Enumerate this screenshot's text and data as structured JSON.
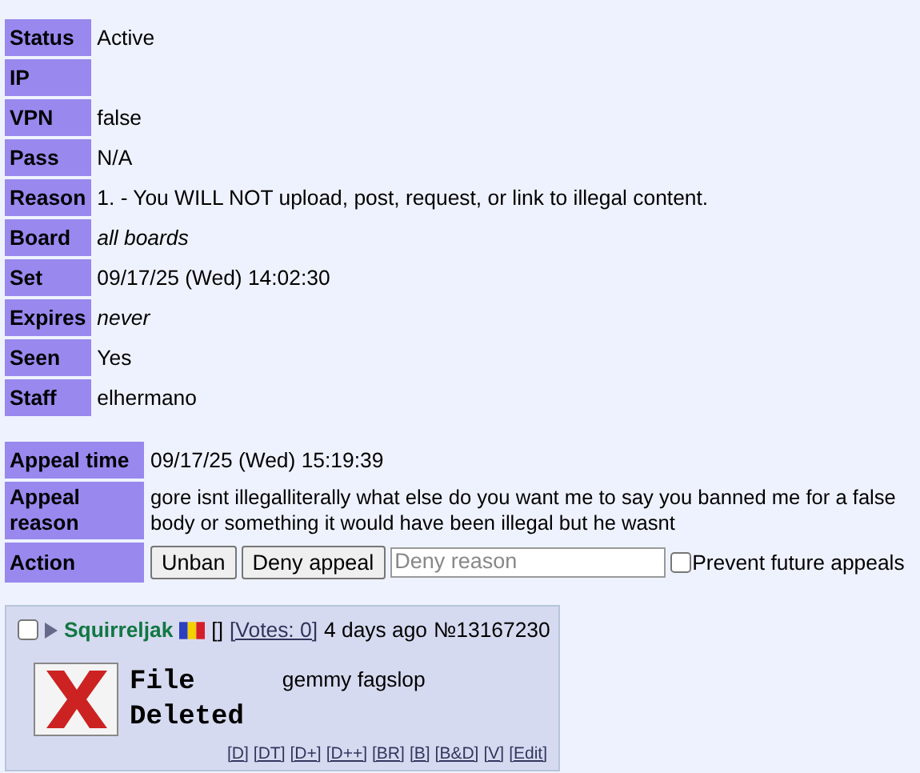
{
  "ban_details": [
    {
      "label": "Status",
      "value": "Active",
      "italic": false
    },
    {
      "label": "IP"
    },
    {
      "label": "VPN",
      "value": "false",
      "italic": false
    },
    {
      "label": "Pass",
      "value": "N/A",
      "italic": false
    },
    {
      "label": "Reason",
      "value": "1. - You WILL NOT upload, post, request, or link to illegal content.",
      "italic": false
    },
    {
      "label": "Board",
      "value": "all boards",
      "italic": true
    },
    {
      "label": "Set",
      "value": "09/17/25 (Wed) 14:02:30",
      "italic": false
    },
    {
      "label": "Expires",
      "value": "never",
      "italic": true
    },
    {
      "label": "Seen",
      "value": "Yes",
      "italic": false
    },
    {
      "label": "Staff",
      "value": "elhermano",
      "italic": false
    }
  ],
  "appeal": {
    "time_label": "Appeal time",
    "time": "09/17/25 (Wed) 15:19:39",
    "reason_label": "Appeal reason",
    "reason_lines": [
      "gore isnt illegalliterally what else do you want me to say you banned me for a false",
      "body or something it would have been illegal but he wasnt"
    ],
    "action_label": "Action",
    "unban_button": "Unban",
    "deny_button": "Deny appeal",
    "deny_reason": {
      "placeholder": "Deny reason"
    },
    "prevent_future_appeals": {
      "label": "Prevent future appeals",
      "checked": false
    }
  },
  "post": {
    "selected": false,
    "name": "Squirreljak",
    "brackets": "[]",
    "votes": "[Votes: 0]",
    "time": "4 days ago",
    "number": "№13167230",
    "file_deleted_lines": [
      "File",
      "Deleted"
    ],
    "comment": "gemmy fagslop",
    "actions": [
      "[D]",
      "[DT]",
      "[D+]",
      "[D++]",
      "[BR]",
      "[B]",
      "[B&D]",
      "[V]",
      "[Edit]"
    ]
  }
}
